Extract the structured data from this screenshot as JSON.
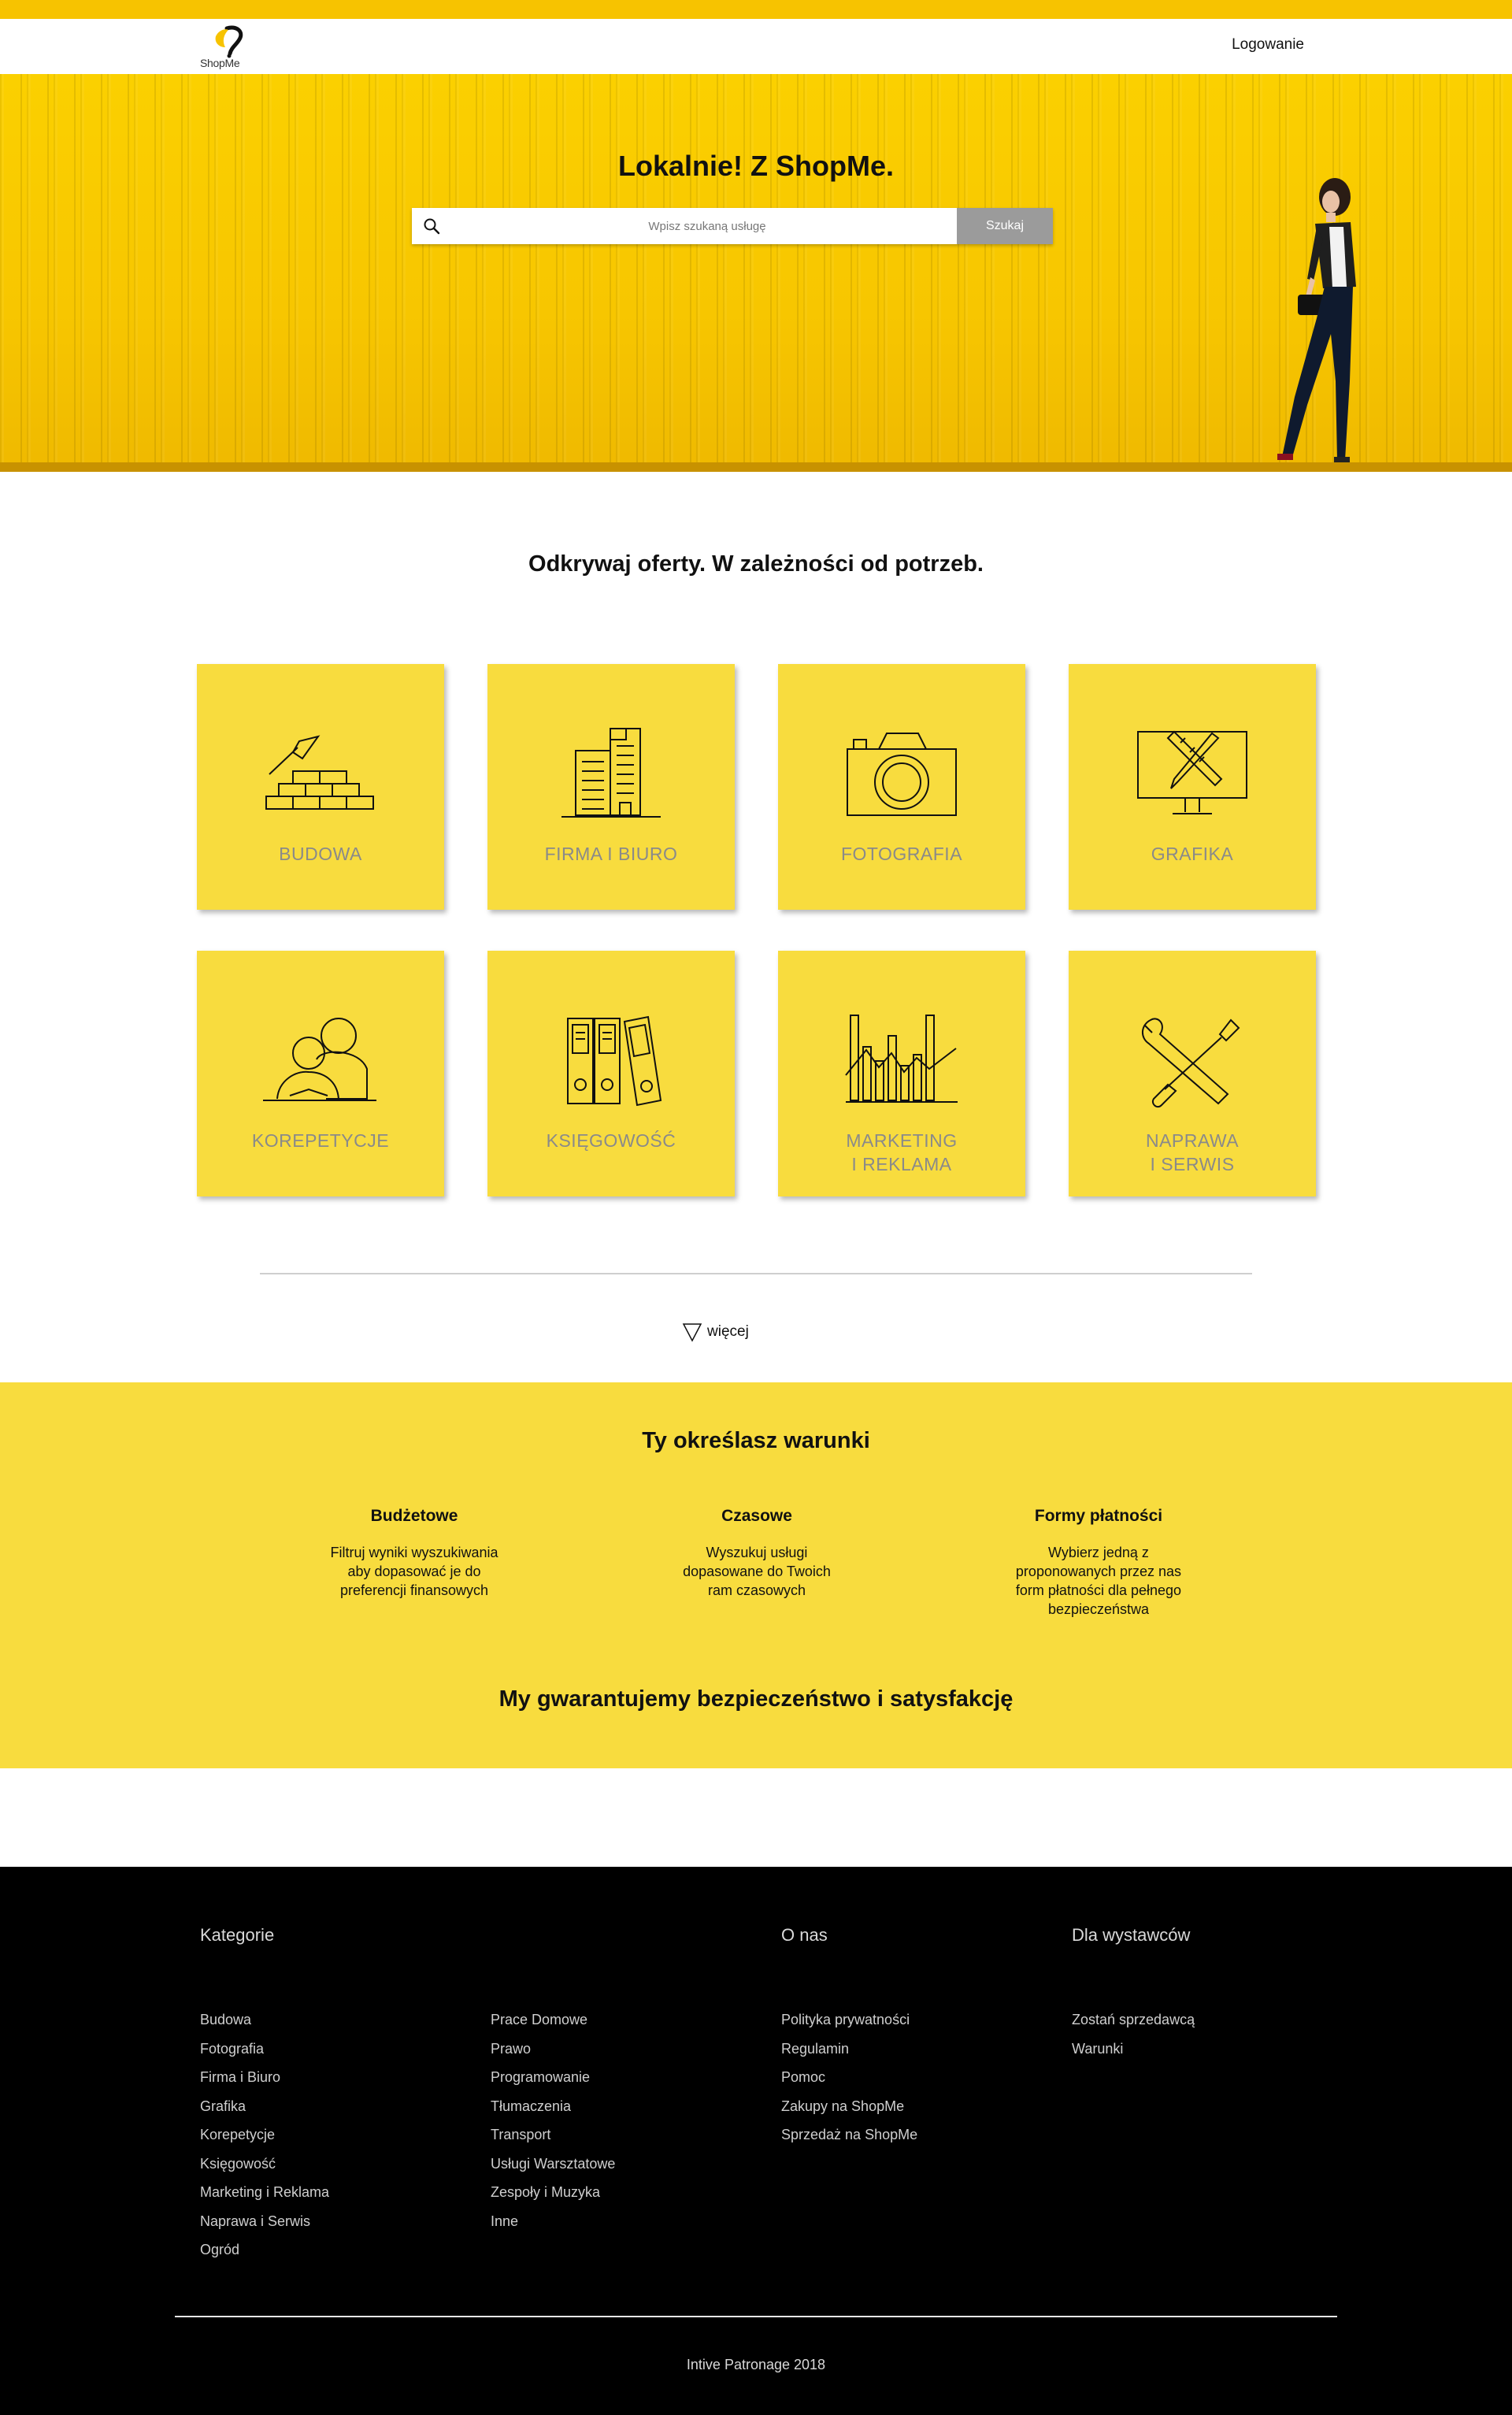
{
  "header": {
    "logo_text": "ShopMe",
    "login": "Logowanie"
  },
  "hero": {
    "title": "Lokalnie! Z ShopMe.",
    "search_placeholder": "Wpisz szukaną usługę",
    "search_button": "Szukaj"
  },
  "discover": {
    "title": "Odkrywaj oferty. W zależności od potrzeb.",
    "tiles": [
      {
        "label": "BUDOWA",
        "icon": "bricks-trowel-icon"
      },
      {
        "label": "FIRMA I BIURO",
        "icon": "office-buildings-icon"
      },
      {
        "label": "FOTOGRAFIA",
        "icon": "camera-icon"
      },
      {
        "label": "GRAFIKA",
        "icon": "monitor-pencil-ruler-icon"
      },
      {
        "label": "KOREPETYCJE",
        "icon": "tutoring-people-book-icon"
      },
      {
        "label": "KSIĘGOWOŚĆ",
        "icon": "binders-icon"
      },
      {
        "label": "MARKETING\nI REKLAMA",
        "icon": "bar-line-chart-icon"
      },
      {
        "label": "NAPRAWA\nI SERWIS",
        "icon": "wrench-screwdriver-icon"
      }
    ],
    "more_label": "więcej"
  },
  "conditions": {
    "title": "Ty określasz warunki",
    "features": [
      {
        "title": "Budżetowe",
        "text": "Filtruj wyniki wyszukiwania aby dopasować je do preferencji finansowych"
      },
      {
        "title": "Czasowe",
        "text": "Wyszukuj usługi dopasowane do Twoich ram czasowych"
      },
      {
        "title": "Formy płatności",
        "text": "Wybierz jedną z proponowanych przez nas form płatności dla pełnego bezpieczeństwa"
      }
    ],
    "guarantee": "My gwarantujemy bezpieczeństwo i satysfakcję"
  },
  "footer": {
    "categories_heading": "Kategorie",
    "about_heading": "O nas",
    "exhibitors_heading": "Dla wystawców",
    "categories_col1": [
      "Budowa",
      "Fotografia",
      "Firma i Biuro",
      "Grafika",
      "Korepetycje",
      "Księgowość",
      "Marketing i Reklama",
      "Naprawa i Serwis",
      "Ogród"
    ],
    "categories_col2": [
      "Prace Domowe",
      "Prawo",
      "Programowanie",
      "Tłumaczenia",
      "Transport",
      "Usługi Warsztatowe",
      "Zespoły i Muzyka",
      "Inne"
    ],
    "about": [
      "Polityka prywatności",
      "Regulamin",
      "Pomoc",
      "Zakupy na ShopMe",
      "Sprzedaż na ShopMe"
    ],
    "exhibitors": [
      "Zostań sprzedawcą",
      "Warunki"
    ],
    "copyright": "Intive Patronage 2018"
  },
  "colors": {
    "brand_yellow": "#f8dc3e",
    "hero_yellow": "#f7c600",
    "footer_bg": "#000000",
    "search_button_bg": "#9b9b9b"
  }
}
